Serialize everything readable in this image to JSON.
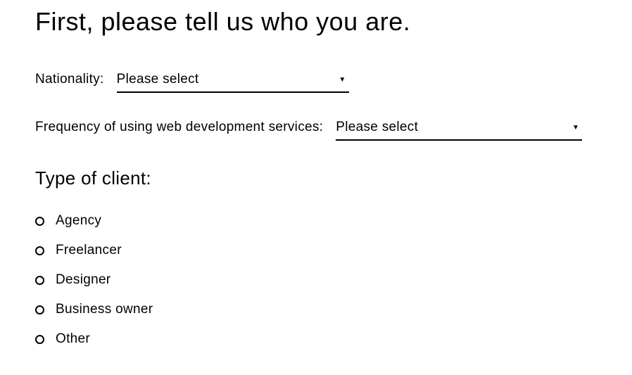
{
  "heading": "First, please tell us who you are.",
  "fields": {
    "nationality": {
      "label": "Nationality:",
      "selected": "Please select"
    },
    "frequency": {
      "label": "Frequency of using web development services:",
      "selected": "Please select"
    }
  },
  "clientType": {
    "label": "Type of client:",
    "options": [
      "Agency",
      "Freelancer",
      "Designer",
      "Business owner",
      "Other"
    ]
  }
}
